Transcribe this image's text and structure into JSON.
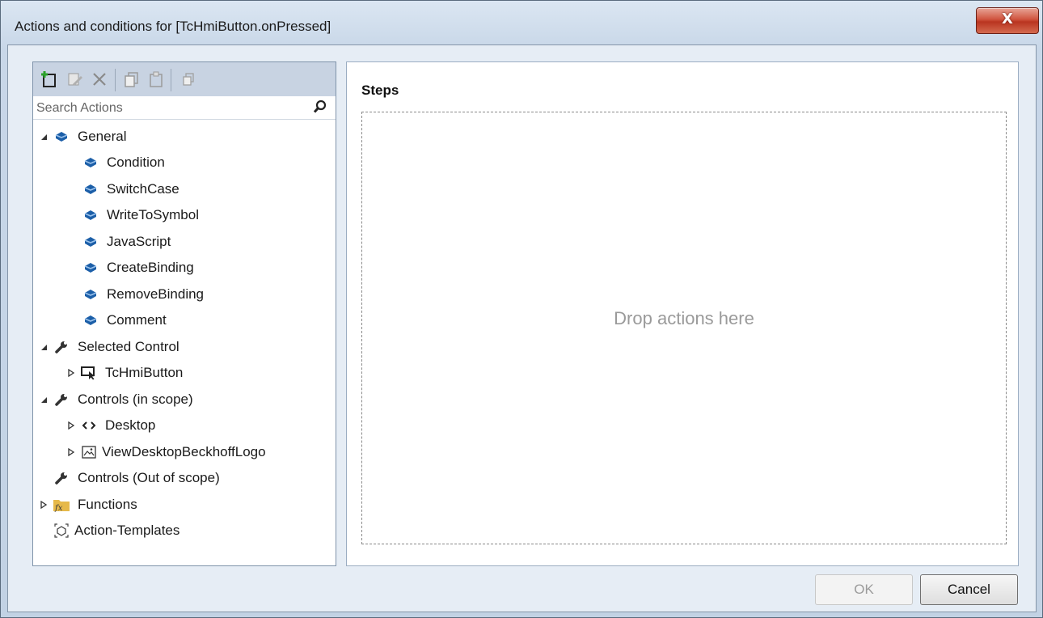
{
  "window": {
    "title": "Actions and conditions for [TcHmiButton.onPressed]",
    "close_label": "X"
  },
  "toolbar": {
    "icons": [
      "add-icon",
      "edit-icon",
      "delete-icon",
      "copy-icon",
      "paste-icon",
      "duplicate-icon"
    ]
  },
  "search": {
    "placeholder": "Search Actions"
  },
  "tree": {
    "general": "General",
    "condition": "Condition",
    "switchcase": "SwitchCase",
    "writetosymbol": "WriteToSymbol",
    "javascript": "JavaScript",
    "createbinding": "CreateBinding",
    "removebinding": "RemoveBinding",
    "comment": "Comment",
    "selected_control": "Selected Control",
    "tchmibutton": "TcHmiButton",
    "controls_in_scope": "Controls (in scope)",
    "desktop": "Desktop",
    "viewdesktoplogo": "ViewDesktopBeckhoffLogo",
    "controls_out_scope": "Controls (Out of scope)",
    "functions": "Functions",
    "action_templates": "Action-Templates"
  },
  "steps": {
    "label": "Steps",
    "drop_text": "Drop actions here"
  },
  "buttons": {
    "ok": "OK",
    "cancel": "Cancel"
  },
  "colors": {
    "action_icon": "#1c5fa8",
    "close_button": "#c9452f",
    "functions_folder": "#e6b94a"
  }
}
